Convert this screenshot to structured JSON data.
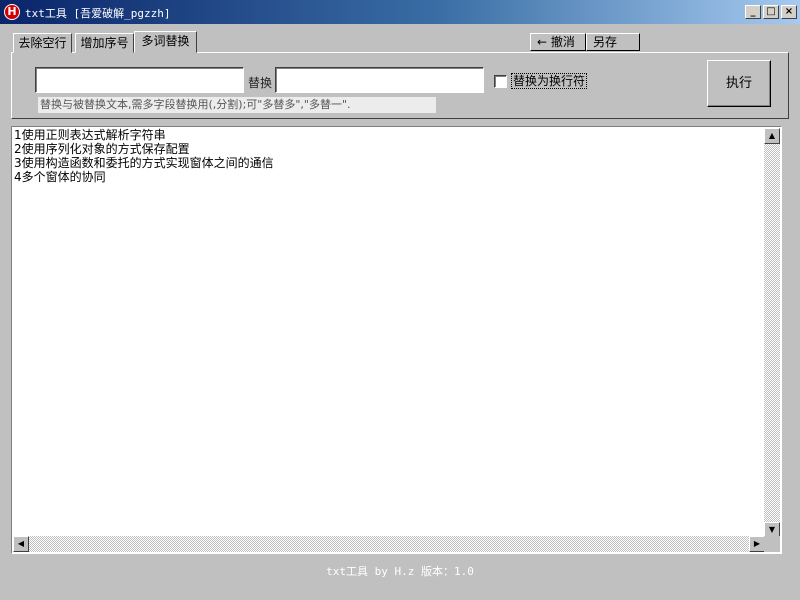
{
  "window": {
    "app_icon": "H",
    "title": "txt工具 [吾爱破解_pgzzh]",
    "controls": {
      "minimize_icon": "minimize-icon",
      "maximize_icon": "maximize-icon",
      "close_icon": "close-icon",
      "minimize": "_",
      "maximize": "□",
      "close": "×"
    }
  },
  "tabs": [
    {
      "label": "去除空行",
      "active": false
    },
    {
      "label": "增加序号",
      "active": false
    },
    {
      "label": "多词替换",
      "active": true
    }
  ],
  "toolbar": {
    "undo_icon": "left-arrow-icon",
    "undo_glyph": "←",
    "undo_label": "撤消",
    "saveas_label": "另存"
  },
  "replace_panel": {
    "find_value": "",
    "replace_label": "替换",
    "replace_value": "",
    "newline_checkbox_label": "替换为换行符",
    "newline_checked": false,
    "execute_label": "执行",
    "hint": "替换与被替换文本,需多字段替换用(,分割);可\"多替多\",\"多替一\"."
  },
  "editor": {
    "lines": [
      "1使用正则表达式解析字符串",
      "2使用序列化对象的方式保存配置",
      "3使用构造函数和委托的方式实现窗体之间的通信",
      "4多个窗体的协同"
    ]
  },
  "footer": "txt工具 by H.z  版本：1.0"
}
